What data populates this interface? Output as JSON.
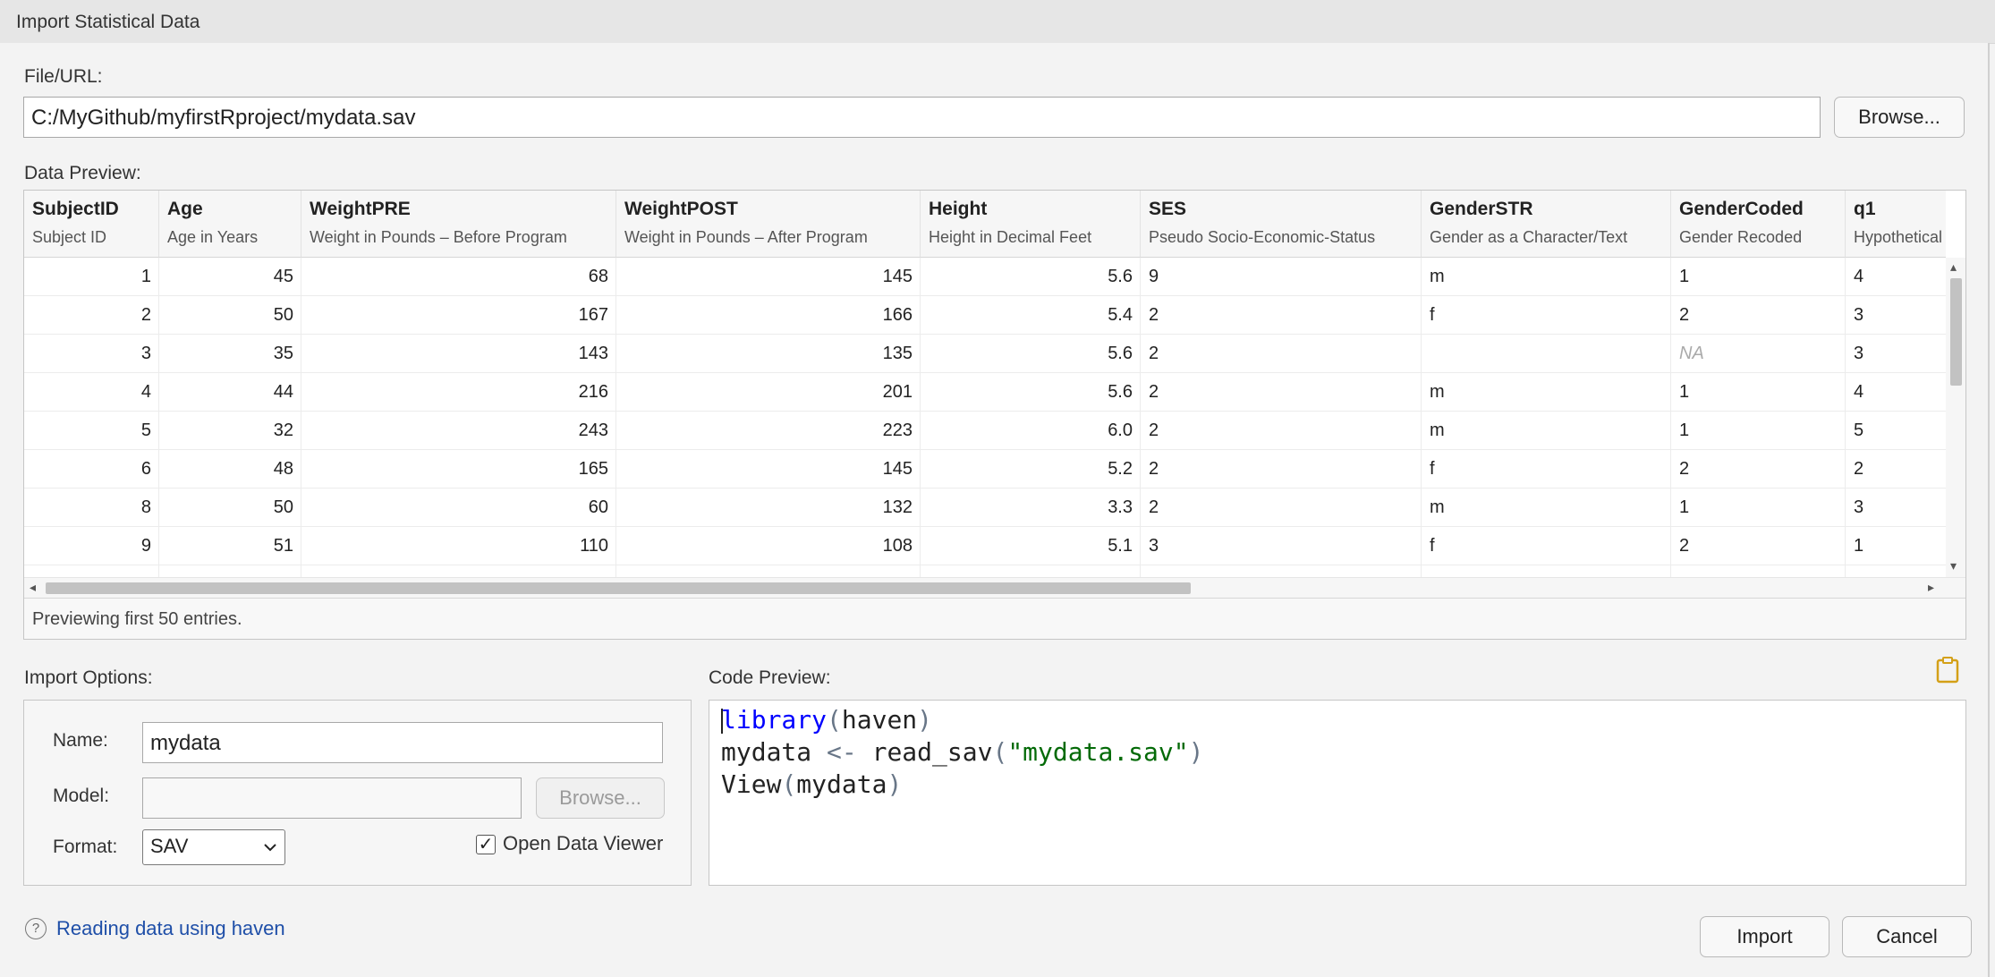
{
  "window": {
    "title": "Import Statistical Data"
  },
  "file": {
    "label": "File/URL:",
    "value": "C:/MyGithub/myfirstRproject/mydata.sav",
    "browse_label": "Browse..."
  },
  "preview": {
    "label": "Data Preview:",
    "columns": [
      {
        "name": "SubjectID",
        "desc": "Subject ID"
      },
      {
        "name": "Age",
        "desc": "Age in Years"
      },
      {
        "name": "WeightPRE",
        "desc": "Weight in Pounds – Before Program"
      },
      {
        "name": "WeightPOST",
        "desc": "Weight in Pounds – After Program"
      },
      {
        "name": "Height",
        "desc": "Height in Decimal Feet"
      },
      {
        "name": "SES",
        "desc": "Pseudo Socio-Economic-Status"
      },
      {
        "name": "GenderSTR",
        "desc": "Gender as a Character/Text"
      },
      {
        "name": "GenderCoded",
        "desc": "Gender Recoded"
      },
      {
        "name": "q1",
        "desc": "Hypothetical Q"
      }
    ],
    "rows": [
      [
        "1",
        "45",
        "68",
        "145",
        "5.6",
        "9",
        "m",
        "1",
        "4"
      ],
      [
        "2",
        "50",
        "167",
        "166",
        "5.4",
        "2",
        "f",
        "2",
        "3"
      ],
      [
        "3",
        "35",
        "143",
        "135",
        "5.6",
        "2",
        "",
        "NA",
        "3"
      ],
      [
        "4",
        "44",
        "216",
        "201",
        "5.6",
        "2",
        "m",
        "1",
        "4"
      ],
      [
        "5",
        "32",
        "243",
        "223",
        "6.0",
        "2",
        "m",
        "1",
        "5"
      ],
      [
        "6",
        "48",
        "165",
        "145",
        "5.2",
        "2",
        "f",
        "2",
        "2"
      ],
      [
        "8",
        "50",
        "60",
        "132",
        "3.3",
        "2",
        "m",
        "1",
        "3"
      ],
      [
        "9",
        "51",
        "110",
        "108",
        "5.1",
        "3",
        "f",
        "2",
        "1"
      ]
    ],
    "status": "Previewing first 50 entries."
  },
  "options": {
    "label": "Import Options:",
    "name_label": "Name:",
    "name_value": "mydata",
    "model_label": "Model:",
    "model_value": "",
    "model_browse_label": "Browse...",
    "format_label": "Format:",
    "format_value": "SAV",
    "open_viewer_label": "Open Data Viewer",
    "open_viewer_checked": true
  },
  "code": {
    "label": "Code Preview:",
    "line1_fn": "library",
    "line1_open": "(",
    "line1_arg": "haven",
    "line1_close": ")",
    "line2_var": "mydata",
    "line2_op": "<-",
    "line2_fn": "read_sav",
    "line2_open": "(",
    "line2_str": "\"mydata.sav\"",
    "line2_close": ")",
    "line3_fn": "View",
    "line3_open": "(",
    "line3_arg": "mydata",
    "line3_close": ")"
  },
  "footer": {
    "help_glyph": "?",
    "help_link": "Reading data using haven",
    "import_label": "Import",
    "cancel_label": "Cancel"
  }
}
